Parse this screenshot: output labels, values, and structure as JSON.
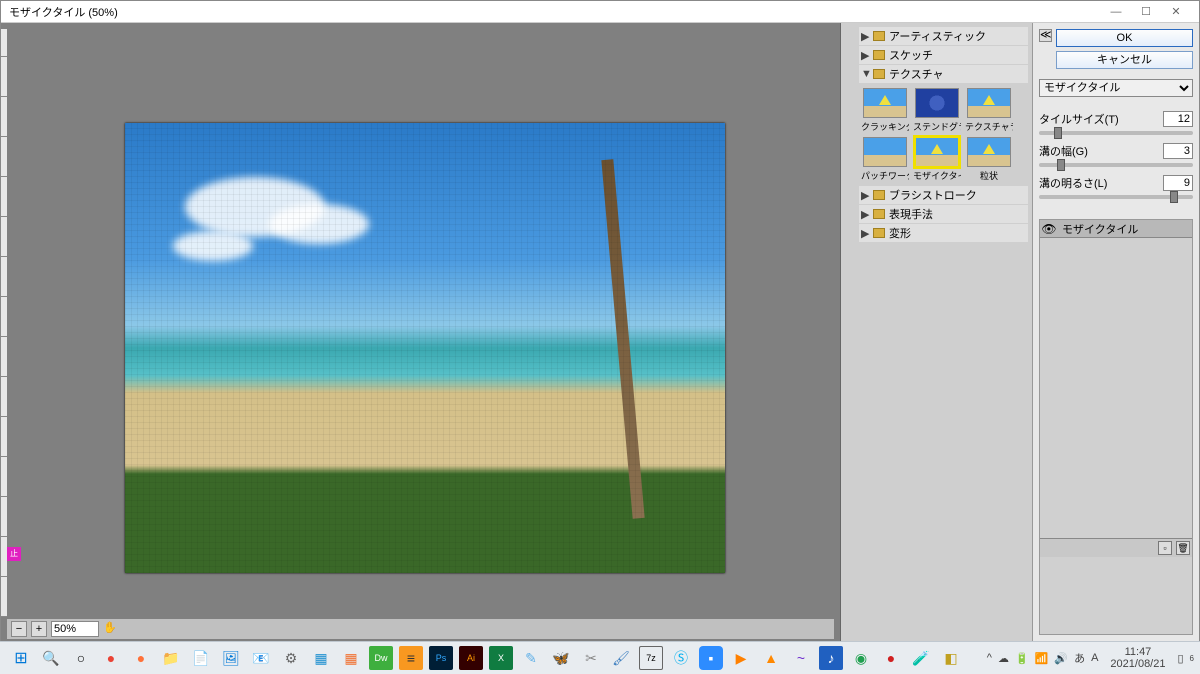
{
  "window": {
    "title": "モザイクタイル (50%)"
  },
  "preview": {
    "zoom": "50%",
    "minus": "−",
    "plus": "+",
    "stop": "止"
  },
  "categories": {
    "artistic": "アーティスティック",
    "sketch": "スケッチ",
    "texture": "テクスチャ",
    "brushstroke": "ブラシストローク",
    "expression": "表現手法",
    "distort": "変形",
    "triangle_closed": "▶",
    "triangle_open": "▼"
  },
  "thumbs": {
    "craquelure": "クラッキング",
    "stained_glass": "ステンドグラス",
    "texturizer": "テクスチャライザー",
    "patchwork": "パッチワーク",
    "mosaic_tiles": "モザイクタイル",
    "grain": "粒状"
  },
  "settings": {
    "ok": "OK",
    "cancel": "キャンセル",
    "filter_name": "モザイクタイル",
    "toggle": "≪",
    "tile_size_label": "タイルサイズ(T)",
    "tile_size_value": "12",
    "grout_width_label": "溝の幅(G)",
    "grout_width_value": "3",
    "grout_light_label": "溝の明るさ(L)",
    "grout_light_value": "9"
  },
  "stack": {
    "eye": "👁",
    "title": "モザイクタイル",
    "new": "▫",
    "trash": "🗑"
  },
  "taskbar": {
    "time": "11:47",
    "date": "2021/08/21",
    "tray_up": "^",
    "tray_cloud": "☁",
    "tray_bat": "🔋",
    "tray_wifi": "📶",
    "tray_vol": "🔊",
    "tray_ime1": "あ",
    "tray_ime2": "A",
    "tray_notif": "▯",
    "tray_badge": "6"
  }
}
